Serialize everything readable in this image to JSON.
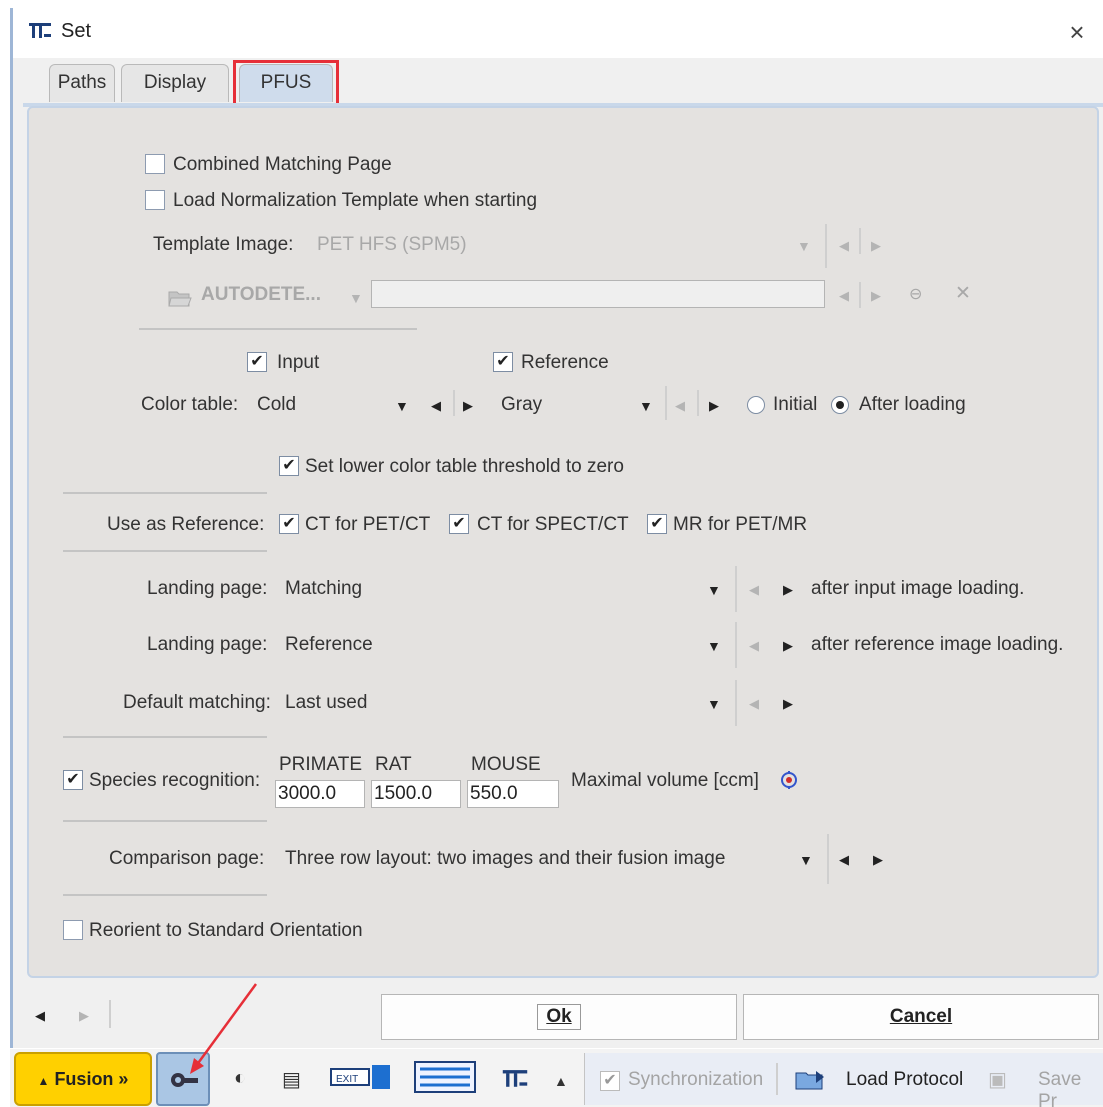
{
  "window": {
    "title": "Set",
    "close_glyph": "×"
  },
  "tabs": [
    {
      "label": "Paths",
      "active": false
    },
    {
      "label": "Display",
      "active": false
    },
    {
      "label": "PFUS",
      "active": true
    }
  ],
  "pfus": {
    "combined_matching_page": {
      "label": "Combined Matching Page",
      "checked": false
    },
    "load_normalization": {
      "label": "Load Normalization Template when starting",
      "checked": false
    },
    "template_image": {
      "label": "Template Image:",
      "value": "PET HFS (SPM5)",
      "enabled": false
    },
    "autodetect": {
      "label": "AUTODETE...",
      "path": "",
      "enabled": false
    },
    "input_checkbox": {
      "label": "Input",
      "checked": true
    },
    "reference_checkbox": {
      "label": "Reference",
      "checked": true
    },
    "color_table": {
      "label": "Color table:",
      "input_value": "Cold",
      "reference_value": "Gray",
      "radio_initial": {
        "label": "Initial",
        "selected": false
      },
      "radio_after_loading": {
        "label": "After loading",
        "selected": true
      }
    },
    "lower_threshold": {
      "label": "Set lower color table threshold to zero",
      "checked": true
    },
    "use_as_reference": {
      "label": "Use as Reference:",
      "options": [
        {
          "label": "CT for PET/CT",
          "checked": true
        },
        {
          "label": "CT for SPECT/CT",
          "checked": true
        },
        {
          "label": "MR for PET/MR",
          "checked": true
        }
      ]
    },
    "landing_input": {
      "label": "Landing page:",
      "value": "Matching",
      "suffix": "after input image loading."
    },
    "landing_reference": {
      "label": "Landing page:",
      "value": "Reference",
      "suffix": "after reference image loading."
    },
    "default_matching": {
      "label": "Default matching:",
      "value": "Last used"
    },
    "species": {
      "label": "Species recognition:",
      "checked": true,
      "headers": [
        "PRIMATE",
        "RAT",
        "MOUSE"
      ],
      "values": [
        "3000.0",
        "1500.0",
        "550.0"
      ],
      "volume_label": "Maximal volume [ccm]"
    },
    "comparison_page": {
      "label": "Comparison page:",
      "value": "Three row layout: two images and their fusion image"
    },
    "reorient": {
      "label": "Reorient to Standard Orientation",
      "checked": false
    }
  },
  "buttons": {
    "ok": "Ok",
    "cancel": "Cancel"
  },
  "taskbar": {
    "fusion": "Fusion »",
    "synchronization": "Synchronization",
    "load_protocol": "Load Protocol",
    "save_protocol": "Save Pr"
  },
  "colors": {
    "highlight": "#e62f38",
    "fusion": "#ffd000",
    "panel": "#e4e2e0",
    "tab_active": "#cfdcec"
  }
}
